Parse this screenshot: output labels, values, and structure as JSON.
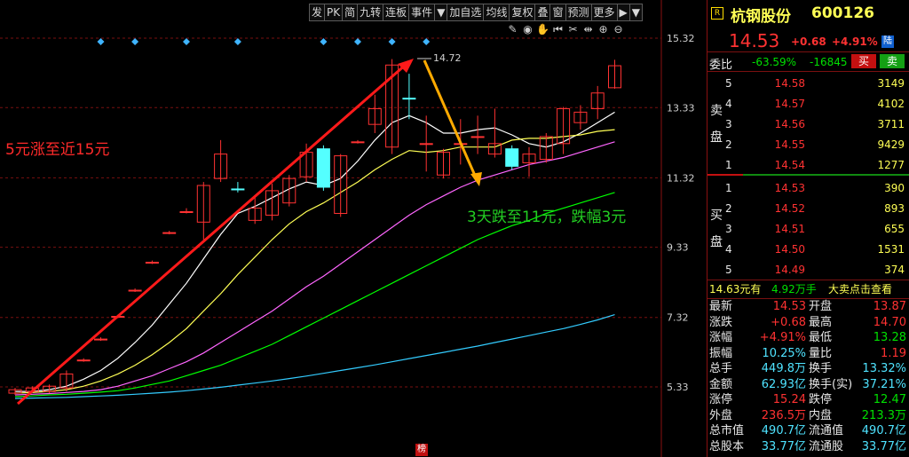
{
  "toolbar": {
    "items": [
      "发",
      "PK",
      "简",
      "九转",
      "连板",
      "事件",
      "▼",
      "加自选",
      "均线",
      "复权",
      "叠",
      "窗",
      "预测",
      "更多",
      "▶",
      "▼"
    ]
  },
  "chart": {
    "y_ticks": [
      "15.32",
      "13.33",
      "11.32",
      "9.33",
      "7.32",
      "5.33"
    ],
    "y_tick_values": [
      15.32,
      13.33,
      11.32,
      9.33,
      7.32,
      5.33
    ],
    "high_label": "14.72",
    "annotation_left": "5元涨至近15元",
    "annotation_right": "3天跌至11元，跌幅3元",
    "bottom_badge": "榜",
    "toolbar_icons": [
      "pen-icon",
      "eye-icon",
      "hand-icon",
      "rewind-icon",
      "scissors-icon",
      "left-right-icon",
      "zoom-in-icon",
      "zoom-out-icon"
    ]
  },
  "chart_data": {
    "type": "candlestick",
    "ylim": [
      4.8,
      15.9
    ],
    "candles": [
      {
        "o": 5.15,
        "c": 5.25,
        "h": 5.3,
        "l": 5.1,
        "up": true
      },
      {
        "o": 5.2,
        "c": 5.3,
        "h": 5.35,
        "l": 5.15,
        "up": true
      },
      {
        "o": 5.2,
        "c": 5.35,
        "h": 5.4,
        "l": 5.15,
        "up": true
      },
      {
        "o": 5.3,
        "c": 5.7,
        "h": 5.8,
        "l": 5.2,
        "up": true
      },
      {
        "o": 6.1,
        "c": 6.1,
        "h": 6.15,
        "l": 6.05,
        "up": true
      },
      {
        "o": 6.7,
        "c": 6.7,
        "h": 6.75,
        "l": 6.65,
        "up": true
      },
      {
        "o": 7.35,
        "c": 7.35,
        "h": 7.4,
        "l": 7.3,
        "up": true
      },
      {
        "o": 8.1,
        "c": 8.1,
        "h": 8.15,
        "l": 8.05,
        "up": true
      },
      {
        "o": 8.9,
        "c": 8.9,
        "h": 8.95,
        "l": 8.85,
        "up": true
      },
      {
        "o": 9.75,
        "c": 9.75,
        "h": 9.8,
        "l": 9.7,
        "up": true
      },
      {
        "o": 10.35,
        "c": 10.35,
        "h": 10.45,
        "l": 10.3,
        "up": true
      },
      {
        "o": 10.05,
        "c": 11.1,
        "h": 11.2,
        "l": 9.55,
        "up": true
      },
      {
        "o": 11.3,
        "c": 12.0,
        "h": 12.4,
        "l": 11.2,
        "up": true
      },
      {
        "o": 11.0,
        "c": 11.0,
        "h": 11.2,
        "l": 10.9,
        "up": false
      },
      {
        "o": 10.1,
        "c": 10.45,
        "h": 10.8,
        "l": 10.0,
        "up": true
      },
      {
        "o": 10.25,
        "c": 10.95,
        "h": 11.15,
        "l": 10.1,
        "up": true
      },
      {
        "o": 10.6,
        "c": 11.3,
        "h": 11.4,
        "l": 10.5,
        "up": true
      },
      {
        "o": 11.35,
        "c": 12.05,
        "h": 12.3,
        "l": 11.2,
        "up": true
      },
      {
        "o": 12.15,
        "c": 11.05,
        "h": 12.25,
        "l": 10.95,
        "up": false
      },
      {
        "o": 10.3,
        "c": 11.95,
        "h": 12.0,
        "l": 10.2,
        "up": true
      },
      {
        "o": 12.35,
        "c": 12.35,
        "h": 12.4,
        "l": 12.3,
        "up": true
      },
      {
        "o": 12.85,
        "c": 13.3,
        "h": 13.7,
        "l": 12.6,
        "up": true
      },
      {
        "o": 12.2,
        "c": 14.55,
        "h": 14.72,
        "l": 12.0,
        "up": true
      },
      {
        "o": 13.6,
        "c": 13.6,
        "h": 14.3,
        "l": 13.0,
        "up": false
      },
      {
        "o": 12.3,
        "c": 12.3,
        "h": 13.1,
        "l": 11.5,
        "up": true
      },
      {
        "o": 11.4,
        "c": 12.05,
        "h": 12.15,
        "l": 11.3,
        "up": true
      },
      {
        "o": 12.3,
        "c": 12.3,
        "h": 13.0,
        "l": 11.7,
        "up": true
      },
      {
        "o": 12.5,
        "c": 12.5,
        "h": 13.1,
        "l": 12.0,
        "up": true
      },
      {
        "o": 12.0,
        "c": 12.3,
        "h": 13.3,
        "l": 11.9,
        "up": true
      },
      {
        "o": 12.15,
        "c": 11.65,
        "h": 12.25,
        "l": 11.55,
        "up": false
      },
      {
        "o": 11.75,
        "c": 12.0,
        "h": 12.2,
        "l": 11.35,
        "up": true
      },
      {
        "o": 11.85,
        "c": 12.5,
        "h": 12.6,
        "l": 11.75,
        "up": true
      },
      {
        "o": 12.3,
        "c": 13.3,
        "h": 13.35,
        "l": 12.0,
        "up": true
      },
      {
        "o": 12.9,
        "c": 13.2,
        "h": 13.4,
        "l": 12.7,
        "up": true
      },
      {
        "o": 13.3,
        "c": 13.75,
        "h": 13.95,
        "l": 13.0,
        "up": true
      },
      {
        "o": 13.9,
        "c": 14.53,
        "h": 14.7,
        "l": 13.87,
        "up": true
      }
    ],
    "ma_lines": [
      {
        "name": "MA5",
        "color": "#ffffff",
        "values": [
          5.2,
          5.2,
          5.25,
          5.35,
          5.55,
          5.8,
          6.15,
          6.6,
          7.1,
          7.7,
          8.3,
          9.0,
          9.7,
          10.3,
          10.5,
          10.75,
          11.0,
          11.2,
          11.1,
          11.3,
          11.8,
          12.4,
          12.9,
          13.1,
          12.9,
          12.6,
          12.6,
          12.7,
          12.75,
          12.55,
          12.3,
          12.2,
          12.35,
          12.6,
          12.9,
          13.2
        ]
      },
      {
        "name": "MA10",
        "color": "#ffff55",
        "values": [
          5.15,
          5.17,
          5.2,
          5.25,
          5.35,
          5.5,
          5.7,
          5.95,
          6.25,
          6.6,
          7.0,
          7.5,
          8.0,
          8.55,
          9.05,
          9.55,
          10.0,
          10.35,
          10.6,
          10.9,
          11.2,
          11.55,
          11.85,
          12.1,
          12.05,
          12.1,
          12.2,
          12.2,
          12.2,
          12.4,
          12.45,
          12.45,
          12.5,
          12.55,
          12.65,
          12.7
        ]
      },
      {
        "name": "MA20",
        "color": "#ff66ff",
        "values": [
          5.1,
          5.12,
          5.14,
          5.17,
          5.2,
          5.25,
          5.35,
          5.5,
          5.65,
          5.85,
          6.05,
          6.3,
          6.6,
          6.9,
          7.2,
          7.5,
          7.85,
          8.2,
          8.5,
          8.85,
          9.2,
          9.55,
          9.9,
          10.25,
          10.55,
          10.8,
          11.05,
          11.25,
          11.4,
          11.55,
          11.7,
          11.8,
          11.9,
          12.05,
          12.2,
          12.35
        ]
      },
      {
        "name": "MA30",
        "color": "#00ff00",
        "values": [
          5.05,
          5.07,
          5.1,
          5.12,
          5.15,
          5.18,
          5.22,
          5.3,
          5.4,
          5.5,
          5.65,
          5.8,
          5.95,
          6.15,
          6.35,
          6.55,
          6.8,
          7.05,
          7.3,
          7.55,
          7.8,
          8.05,
          8.3,
          8.55,
          8.8,
          9.05,
          9.3,
          9.55,
          9.75,
          9.95,
          10.1,
          10.3,
          10.45,
          10.6,
          10.75,
          10.9
        ]
      },
      {
        "name": "MA60",
        "color": "#33ccff",
        "values": [
          5.0,
          5.01,
          5.02,
          5.03,
          5.05,
          5.07,
          5.09,
          5.12,
          5.15,
          5.18,
          5.22,
          5.27,
          5.32,
          5.38,
          5.44,
          5.5,
          5.57,
          5.64,
          5.72,
          5.8,
          5.88,
          5.96,
          6.05,
          6.14,
          6.23,
          6.32,
          6.41,
          6.5,
          6.6,
          6.7,
          6.8,
          6.9,
          7.0,
          7.12,
          7.25,
          7.4
        ]
      }
    ],
    "diamond_indices": [
      5,
      7,
      10,
      13,
      18,
      20,
      22,
      24
    ]
  },
  "quote": {
    "badge": "R",
    "name": "杭钢股份",
    "code": "600126",
    "price": "14.53",
    "change": "+0.68",
    "change_pct": "+4.91%",
    "tag": "陆",
    "weibi_label": "委比",
    "weibi_pct": "-63.59%",
    "weicha": "-16845",
    "buy_btn": "买",
    "sell_btn": "卖",
    "sell_side_label": "卖盘",
    "buy_side_label": "买盘",
    "asks": [
      {
        "lvl": "5",
        "price": "14.58",
        "vol": "3149"
      },
      {
        "lvl": "4",
        "price": "14.57",
        "vol": "4102"
      },
      {
        "lvl": "3",
        "price": "14.56",
        "vol": "3711"
      },
      {
        "lvl": "2",
        "price": "14.55",
        "vol": "9429"
      },
      {
        "lvl": "1",
        "price": "14.54",
        "vol": "1277"
      }
    ],
    "bids": [
      {
        "lvl": "1",
        "price": "14.53",
        "vol": "390"
      },
      {
        "lvl": "2",
        "price": "14.52",
        "vol": "893"
      },
      {
        "lvl": "3",
        "price": "14.51",
        "vol": "655"
      },
      {
        "lvl": "4",
        "price": "14.50",
        "vol": "1531"
      },
      {
        "lvl": "5",
        "price": "14.49",
        "vol": "374"
      }
    ],
    "bigorder_price": "14.63元有",
    "bigorder_vol": "4.92万手",
    "bigorder_link": "大卖点击查看",
    "stats": [
      {
        "l1": "最新",
        "v1": "14.53",
        "c1": "red",
        "l2": "开盘",
        "v2": "13.87",
        "c2": "red"
      },
      {
        "l1": "涨跌",
        "v1": "+0.68",
        "c1": "red",
        "l2": "最高",
        "v2": "14.70",
        "c2": "red"
      },
      {
        "l1": "涨幅",
        "v1": "+4.91%",
        "c1": "red",
        "l2": "最低",
        "v2": "13.28",
        "c2": "green"
      },
      {
        "l1": "振幅",
        "v1": "10.25%",
        "c1": "cyan",
        "l2": "量比",
        "v2": "1.19",
        "c2": "red"
      },
      {
        "l1": "总手",
        "v1": "449.8万",
        "c1": "cyan",
        "l2": "换手",
        "v2": "13.32%",
        "c2": "cyan"
      },
      {
        "l1": "金额",
        "v1": "62.93亿",
        "c1": "cyan",
        "l2": "换手(实)",
        "v2": "37.21%",
        "c2": "cyan"
      },
      {
        "l1": "涨停",
        "v1": "15.24",
        "c1": "red",
        "l2": "跌停",
        "v2": "12.47",
        "c2": "green"
      },
      {
        "l1": "外盘",
        "v1": "236.5万",
        "c1": "red",
        "l2": "内盘",
        "v2": "213.3万",
        "c2": "green"
      },
      {
        "l1": "总市值",
        "v1": "490.7亿",
        "c1": "cyan",
        "l2": "流通值",
        "v2": "490.7亿",
        "c2": "cyan"
      },
      {
        "l1": "总股本",
        "v1": "33.77亿",
        "c1": "cyan",
        "l2": "流通股",
        "v2": "33.77亿",
        "c2": "cyan"
      }
    ]
  },
  "colors": {
    "up": "#ff3232",
    "down": "#54ffff",
    "ask": "#ff3232",
    "bid": "#00e000",
    "accent": "#8a1010"
  }
}
